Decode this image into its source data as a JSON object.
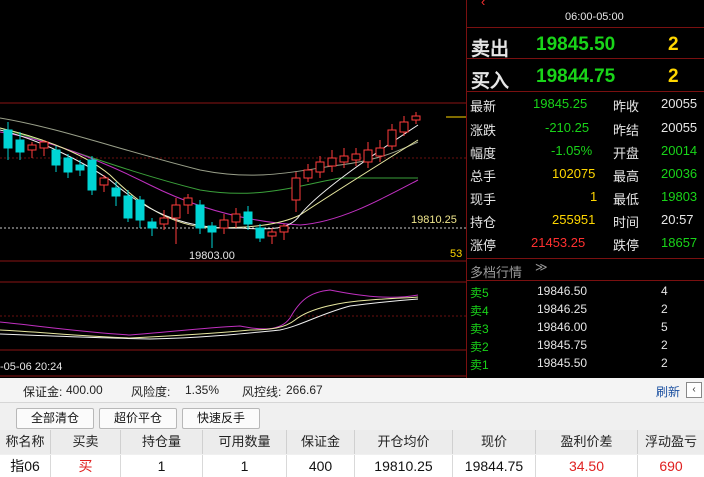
{
  "chart": {
    "price_label": "19810.25",
    "low_label": "19803.00",
    "sub_value": "53",
    "time_label": "-05-06 20:24"
  },
  "panel": {
    "time_range": "06:00-05:00",
    "sell_label": "卖出",
    "sell_price": "19845.50",
    "sell_qty": "2",
    "buy_label": "买入",
    "buy_price": "19844.75",
    "buy_qty": "2",
    "stats": [
      {
        "l1": "最新",
        "v1": "19845.25",
        "l2": "昨收",
        "v2": "20055"
      },
      {
        "l1": "涨跌",
        "v1": "-210.25",
        "l2": "昨结",
        "v2": "20055"
      },
      {
        "l1": "幅度",
        "v1": "-1.05%",
        "l2": "开盘",
        "v2": "20014"
      },
      {
        "l1": "总手",
        "v1": "102075",
        "l2": "最高",
        "v2": "20036"
      },
      {
        "l1": "现手",
        "v1": "1",
        "l2": "最低",
        "v2": "19803"
      },
      {
        "l1": "持仓",
        "v1": "255951",
        "l2": "时间",
        "v2": "20:57"
      },
      {
        "l1": "涨停",
        "v1": "21453.25",
        "l2": "跌停",
        "v2": "18657"
      }
    ],
    "depth_title": "多档行情",
    "depth": [
      {
        "label": "卖5",
        "price": "19846.50",
        "qty": "4"
      },
      {
        "label": "卖4",
        "price": "19846.25",
        "qty": "2"
      },
      {
        "label": "卖3",
        "price": "19846.00",
        "qty": "5"
      },
      {
        "label": "卖2",
        "price": "19845.75",
        "qty": "2"
      },
      {
        "label": "卖1",
        "price": "19845.50",
        "qty": "2"
      }
    ]
  },
  "account": {
    "margin_label": "保证金:",
    "margin": "400.00",
    "risk_label": "风险度:",
    "risk": "1.35%",
    "control_label": "风控线:",
    "control": "266.67",
    "refresh": "刷新"
  },
  "buttons": {
    "close_all": "全部清仓",
    "super_close": "超价平仓",
    "quick_reverse": "快速反手"
  },
  "table": {
    "headers": [
      "称名称",
      "买卖",
      "持仓量",
      "可用数量",
      "保证金",
      "开仓均价",
      "现价",
      "盈利价差",
      "浮动盈亏"
    ],
    "row": [
      "指06",
      "买",
      "1",
      "1",
      "400",
      "19810.25",
      "19844.75",
      "34.50",
      "690"
    ]
  }
}
